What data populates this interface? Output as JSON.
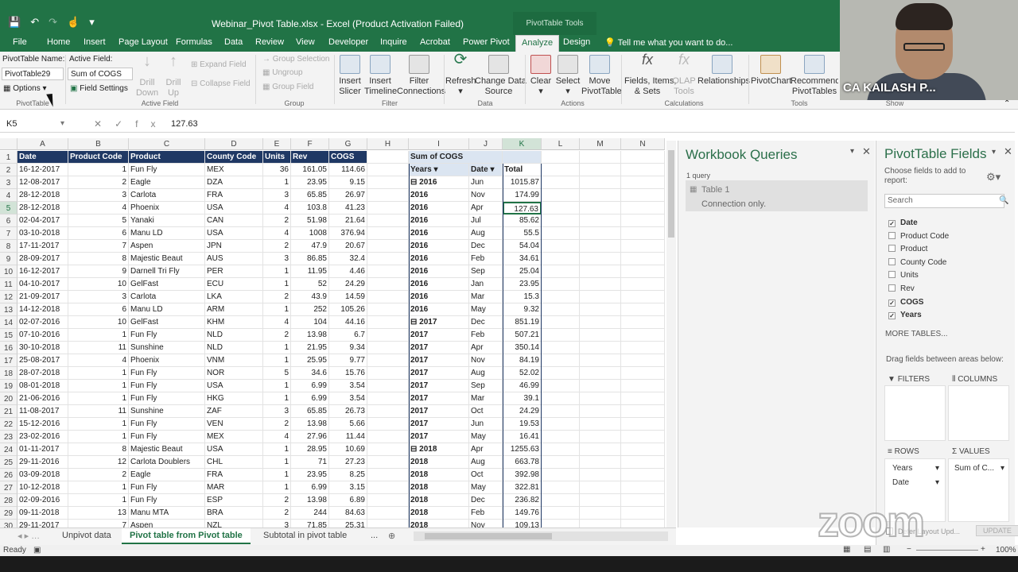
{
  "window": {
    "title": "Webinar_Pivot Table.xlsx - Excel (Product Activation Failed)",
    "context_tab": "PivotTable Tools"
  },
  "tabs": [
    "File",
    "Home",
    "Insert",
    "Page Layout",
    "Formulas",
    "Data",
    "Review",
    "View",
    "Developer",
    "Inquire",
    "Acrobat",
    "Power Pivot",
    "Analyze",
    "Design"
  ],
  "tell_me": "Tell me what you want to do...",
  "ribbon": {
    "pivot_name_label": "PivotTable Name:",
    "pivot_name": "PivotTable29",
    "options": "Options",
    "pivot_group": "PivotTable",
    "active_field_label": "Active Field:",
    "active_field": "Sum of COGS",
    "field_settings": "Field Settings",
    "drill_down": "Drill\nDown",
    "drill_up": "Drill\nUp",
    "expand_field": "Expand Field",
    "collapse_field": "Collapse Field",
    "active_group": "Active Field",
    "group_selection": "Group Selection",
    "ungroup": "Ungroup",
    "group_field": "Group Field",
    "group_group": "Group",
    "insert_slicer": "Insert\nSlicer",
    "insert_timeline": "Insert\nTimeline",
    "filter_conn": "Filter\nConnections",
    "filter_group": "Filter",
    "refresh": "Refresh",
    "change_source": "Change Data\nSource",
    "data_group": "Data",
    "clear": "Clear",
    "select": "Select",
    "move_pivot": "Move\nPivotTable",
    "actions_group": "Actions",
    "fields_items": "Fields, Items,\n& Sets",
    "olap": "OLAP\nTools",
    "relationships": "Relationships",
    "calc_group": "Calculations",
    "pivotchart": "PivotChart",
    "recommended": "Recommended\nPivotTables",
    "tools_group": "Tools",
    "show_group": "Show"
  },
  "webcam": {
    "name": "CA KAILASH P..."
  },
  "formula_bar": {
    "cell": "K5",
    "fx": "fx",
    "value": "127.63"
  },
  "columns": [
    "A",
    "B",
    "C",
    "D",
    "E",
    "F",
    "G",
    "H",
    "I",
    "J",
    "K",
    "L",
    "M",
    "N"
  ],
  "table_headers": [
    "Date",
    "Product Code",
    "Product",
    "County Code",
    "Units",
    "Rev",
    "COGS"
  ],
  "rows": [
    [
      "16-12-2017",
      "1",
      "Fun Fly",
      "MEX",
      "36",
      "161.05",
      "114.66"
    ],
    [
      "12-08-2017",
      "2",
      "Eagle",
      "DZA",
      "1",
      "23.95",
      "9.15"
    ],
    [
      "28-12-2018",
      "3",
      "Carlota",
      "FRA",
      "3",
      "65.85",
      "26.97"
    ],
    [
      "28-12-2018",
      "4",
      "Phoenix",
      "USA",
      "4",
      "103.8",
      "41.23"
    ],
    [
      "02-04-2017",
      "5",
      "Yanaki",
      "CAN",
      "2",
      "51.98",
      "21.64"
    ],
    [
      "03-10-2018",
      "6",
      "Manu LD",
      "USA",
      "4",
      "1008",
      "376.94"
    ],
    [
      "17-11-2017",
      "7",
      "Aspen",
      "JPN",
      "2",
      "47.9",
      "20.67"
    ],
    [
      "28-09-2017",
      "8",
      "Majestic Beaut",
      "AUS",
      "3",
      "86.85",
      "32.4"
    ],
    [
      "16-12-2017",
      "9",
      "Darnell Tri Fly",
      "PER",
      "1",
      "11.95",
      "4.46"
    ],
    [
      "04-10-2017",
      "10",
      "GelFast",
      "ECU",
      "1",
      "52",
      "24.29"
    ],
    [
      "21-09-2017",
      "3",
      "Carlota",
      "LKA",
      "2",
      "43.9",
      "14.59"
    ],
    [
      "14-12-2018",
      "6",
      "Manu LD",
      "ARM",
      "1",
      "252",
      "105.26"
    ],
    [
      "02-07-2016",
      "10",
      "GelFast",
      "KHM",
      "4",
      "104",
      "44.16"
    ],
    [
      "07-10-2016",
      "1",
      "Fun Fly",
      "NLD",
      "2",
      "13.98",
      "6.7"
    ],
    [
      "30-10-2018",
      "11",
      "Sunshine",
      "NLD",
      "1",
      "21.95",
      "9.34"
    ],
    [
      "25-08-2017",
      "4",
      "Phoenix",
      "VNM",
      "1",
      "25.95",
      "9.77"
    ],
    [
      "28-07-2018",
      "1",
      "Fun Fly",
      "NOR",
      "5",
      "34.6",
      "15.76"
    ],
    [
      "08-01-2018",
      "1",
      "Fun Fly",
      "USA",
      "1",
      "6.99",
      "3.54"
    ],
    [
      "21-06-2016",
      "1",
      "Fun Fly",
      "HKG",
      "1",
      "6.99",
      "3.54"
    ],
    [
      "11-08-2017",
      "11",
      "Sunshine",
      "ZAF",
      "3",
      "65.85",
      "26.73"
    ],
    [
      "15-12-2016",
      "1",
      "Fun Fly",
      "VEN",
      "2",
      "13.98",
      "5.66"
    ],
    [
      "23-02-2016",
      "1",
      "Fun Fly",
      "MEX",
      "4",
      "27.96",
      "11.44"
    ],
    [
      "01-11-2017",
      "8",
      "Majestic Beaut",
      "USA",
      "1",
      "28.95",
      "10.69"
    ],
    [
      "29-11-2016",
      "12",
      "Carlota Doublers",
      "CHL",
      "1",
      "71",
      "27.23"
    ],
    [
      "03-09-2018",
      "2",
      "Eagle",
      "FRA",
      "1",
      "23.95",
      "8.25"
    ],
    [
      "10-12-2018",
      "1",
      "Fun Fly",
      "MAR",
      "1",
      "6.99",
      "3.15"
    ],
    [
      "02-09-2016",
      "1",
      "Fun Fly",
      "ESP",
      "2",
      "13.98",
      "6.89"
    ],
    [
      "09-11-2018",
      "13",
      "Manu MTA",
      "BRA",
      "2",
      "244",
      "84.63"
    ],
    [
      "29-11-2017",
      "7",
      "Aspen",
      "NZL",
      "3",
      "71.85",
      "25.31"
    ]
  ],
  "pivot": {
    "title": "Sum of COGS",
    "years_header": "Years",
    "date_header": "Date",
    "total_header": "Total",
    "rows": [
      [
        "2016",
        "Jun",
        "1015.87"
      ],
      [
        "2016",
        "Nov",
        "174.99"
      ],
      [
        "2016",
        "Apr",
        "127.63"
      ],
      [
        "2016",
        "Jul",
        "85.62"
      ],
      [
        "2016",
        "Aug",
        "55.5"
      ],
      [
        "2016",
        "Dec",
        "54.04"
      ],
      [
        "2016",
        "Feb",
        "34.61"
      ],
      [
        "2016",
        "Sep",
        "25.04"
      ],
      [
        "2016",
        "Jan",
        "23.95"
      ],
      [
        "2016",
        "Mar",
        "15.3"
      ],
      [
        "2016",
        "May",
        "9.32"
      ],
      [
        "2017",
        "Dec",
        "851.19"
      ],
      [
        "2017",
        "Feb",
        "507.21"
      ],
      [
        "2017",
        "Apr",
        "350.14"
      ],
      [
        "2017",
        "Nov",
        "84.19"
      ],
      [
        "2017",
        "Aug",
        "52.02"
      ],
      [
        "2017",
        "Sep",
        "46.99"
      ],
      [
        "2017",
        "Mar",
        "39.1"
      ],
      [
        "2017",
        "Oct",
        "24.29"
      ],
      [
        "2017",
        "Jun",
        "19.53"
      ],
      [
        "2017",
        "May",
        "16.41"
      ],
      [
        "2018",
        "Apr",
        "1255.63"
      ],
      [
        "2018",
        "Aug",
        "663.78"
      ],
      [
        "2018",
        "Oct",
        "392.98"
      ],
      [
        "2018",
        "May",
        "322.81"
      ],
      [
        "2018",
        "Dec",
        "236.82"
      ],
      [
        "2018",
        "Feb",
        "149.76"
      ],
      [
        "2018",
        "Nov",
        "109.13"
      ]
    ]
  },
  "sheet_tabs": [
    "Unpivot data",
    "Pivot table from Pivot table",
    "Subtotal in pivot table",
    "..."
  ],
  "status": {
    "ready": "Ready",
    "zoom": "100%"
  },
  "workbook_queries": {
    "title": "Workbook Queries",
    "count": "1 query",
    "item_name": "Table 1",
    "item_status": "Connection only."
  },
  "pivot_fields": {
    "title": "PivotTable Fields",
    "subtitle": "Choose fields to add to report:",
    "search": "Search",
    "fields": [
      {
        "name": "Date",
        "checked": true
      },
      {
        "name": "Product Code",
        "checked": false
      },
      {
        "name": "Product",
        "checked": false
      },
      {
        "name": "County Code",
        "checked": false
      },
      {
        "name": "Units",
        "checked": false
      },
      {
        "name": "Rev",
        "checked": false
      },
      {
        "name": "COGS",
        "checked": true
      },
      {
        "name": "Years",
        "checked": true
      }
    ],
    "more_tables": "MORE TABLES...",
    "drag_hint": "Drag fields between areas below:",
    "filters": "FILTERS",
    "columns": "COLUMNS",
    "rows": "ROWS",
    "values": "VALUES",
    "rows_items": [
      "Years",
      "Date"
    ],
    "values_items": [
      "Sum of C..."
    ],
    "defer": "Defer Layout Upd...",
    "update": "UPDATE"
  },
  "watermark": "zoom"
}
